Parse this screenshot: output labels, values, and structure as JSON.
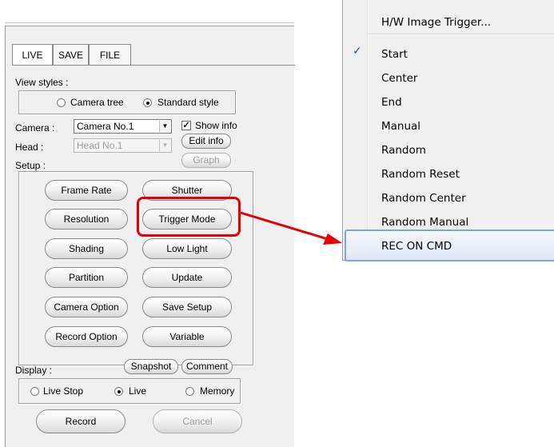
{
  "tabs": [
    "LIVE",
    "SAVE",
    "FILE"
  ],
  "view_styles": {
    "label": "View styles :",
    "options": [
      "Camera tree",
      "Standard style"
    ],
    "selected": "Standard style"
  },
  "camera": {
    "label": "Camera :",
    "value": "Camera No.1"
  },
  "head": {
    "label": "Head :",
    "value": "Head No.1"
  },
  "show_info": {
    "label": "Show info",
    "checked": true,
    "check_glyph": "✓"
  },
  "edit_info_label": "Edit info",
  "graph_label": "Graph",
  "setup_label": "Setup :",
  "setup_buttons": [
    "Frame Rate",
    "Shutter",
    "Resolution",
    "Trigger Mode",
    "Shading",
    "Low Light",
    "Partition",
    "Update",
    "Camera Option",
    "Save Setup",
    "Record Option",
    "Variable"
  ],
  "display": {
    "label": "Display :",
    "snapshot_label": "Snapshot",
    "comment_label": "Comment",
    "options": [
      "Live Stop",
      "Live",
      "Memory"
    ],
    "selected": "Live"
  },
  "record_label": "Record",
  "cancel_label": "Cancel",
  "menu": {
    "items": [
      "H/W Image Trigger...",
      "Start",
      "Center",
      "End",
      "Manual",
      "Random",
      "Random Reset",
      "Random Center",
      "Random Manual",
      "REC ON CMD"
    ],
    "checked": "Start",
    "check_glyph": "✓",
    "hovered": "REC ON CMD"
  },
  "colors": {
    "annotation": "#e60000",
    "menu_hover_border": "#7ea6d6",
    "check": "#1c4f9a"
  },
  "icons": [
    "checkmark-icon",
    "dropdown-arrow-icon",
    "arrow-annotation"
  ]
}
